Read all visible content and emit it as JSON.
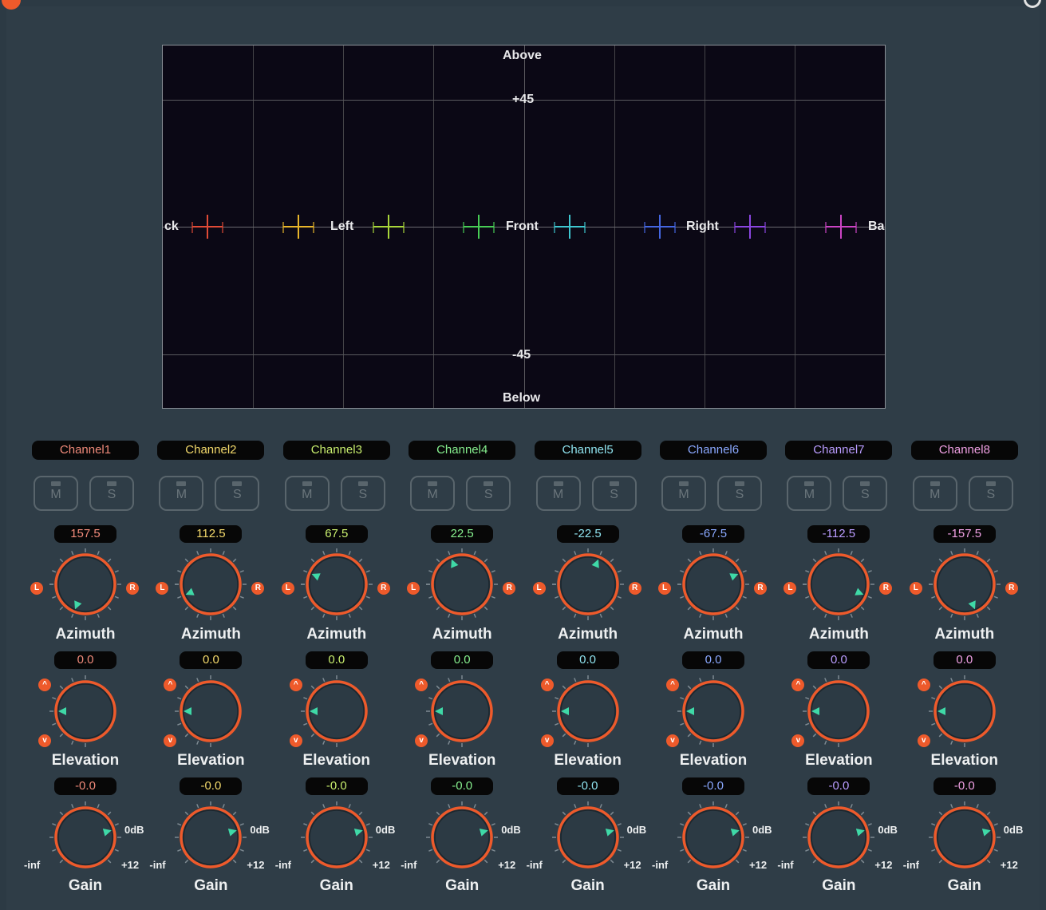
{
  "panner": {
    "above": "Above",
    "below": "Below",
    "plus45": "+45",
    "minus45": "-45",
    "back_left_partial": "ck",
    "left": "Left",
    "front": "Front",
    "right": "Right",
    "back_right_partial": "Ba"
  },
  "labels": {
    "mute": "M",
    "solo": "S",
    "azimuth": "Azimuth",
    "elevation": "Elevation",
    "gain": "Gain",
    "L": "L",
    "R": "R",
    "up": "^",
    "down": "v",
    "gain_min": "-inf",
    "gain_zero": "0dB",
    "gain_max": "+12"
  },
  "channels": [
    {
      "name": "Channel1",
      "color": "#f08a7a",
      "azimuth": "157.5",
      "elevation": "0.0",
      "gain": "-0.0"
    },
    {
      "name": "Channel2",
      "color": "#f3d96b",
      "azimuth": "112.5",
      "elevation": "0.0",
      "gain": "-0.0"
    },
    {
      "name": "Channel3",
      "color": "#c9ef6e",
      "azimuth": "67.5",
      "elevation": "0.0",
      "gain": "-0.0"
    },
    {
      "name": "Channel4",
      "color": "#86ef8e",
      "azimuth": "22.5",
      "elevation": "0.0",
      "gain": "-0.0"
    },
    {
      "name": "Channel5",
      "color": "#8fe3ef",
      "azimuth": "-22.5",
      "elevation": "0.0",
      "gain": "-0.0"
    },
    {
      "name": "Channel6",
      "color": "#8aa8ff",
      "azimuth": "-67.5",
      "elevation": "0.0",
      "gain": "-0.0"
    },
    {
      "name": "Channel7",
      "color": "#b99cff",
      "azimuth": "-112.5",
      "elevation": "0.0",
      "gain": "-0.0"
    },
    {
      "name": "Channel8",
      "color": "#f0a0e4",
      "azimuth": "-157.5",
      "elevation": "0.0",
      "gain": "-0.0"
    }
  ],
  "marker_colors": [
    "#e04a36",
    "#e8b52a",
    "#a8d63a",
    "#47cc55",
    "#3ec6cf",
    "#4466e0",
    "#8a45e0",
    "#cc44c4"
  ],
  "accent": "#ee5a2b",
  "pointer_color": "#3fd9a7"
}
